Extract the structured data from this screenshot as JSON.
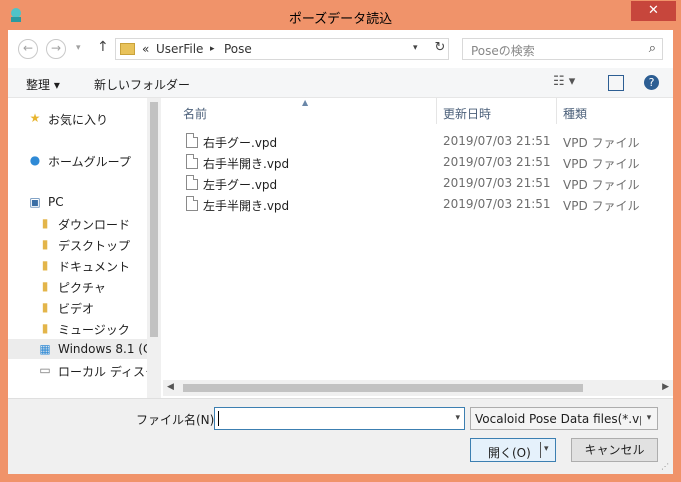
{
  "window": {
    "title": "ポーズデータ読込",
    "close_glyph": "✕",
    "accent": "#f0936a"
  },
  "nav": {
    "back_glyph": "←",
    "forward_glyph": "→",
    "recent_glyph": "▾",
    "up_glyph": "↑",
    "crumb_prefix": "«",
    "breadcrumb": [
      "UserFile",
      "Pose"
    ],
    "crumb_sep": "▸",
    "refresh_glyph": "↻",
    "search_placeholder": "Poseの検索",
    "search_glyph": "⌕"
  },
  "toolbar": {
    "organize_label": "整理 ▾",
    "new_folder_label": "新しいフォルダー",
    "view_glyph": "☷ ▾",
    "help_glyph": "?"
  },
  "sidebar": {
    "items": [
      {
        "label": "お気に入り",
        "icon": "star-icon",
        "glyph": "★"
      },
      {
        "label": "ホームグループ",
        "icon": "homegroup-icon",
        "glyph": "●"
      },
      {
        "label": "PC",
        "icon": "computer-icon",
        "glyph": "▣"
      },
      {
        "label": "ダウンロード",
        "icon": "folder-icon",
        "glyph": "▮"
      },
      {
        "label": "デスクトップ",
        "icon": "folder-icon",
        "glyph": "▮"
      },
      {
        "label": "ドキュメント",
        "icon": "folder-icon",
        "glyph": "▮"
      },
      {
        "label": "ピクチャ",
        "icon": "folder-icon",
        "glyph": "▮"
      },
      {
        "label": "ビデオ",
        "icon": "folder-icon",
        "glyph": "▮"
      },
      {
        "label": "ミュージック",
        "icon": "folder-icon",
        "glyph": "▮"
      },
      {
        "label": "Windows 8.1 (C",
        "icon": "windows-drive-icon",
        "glyph": "▦"
      },
      {
        "label": "ローカル ディスク (",
        "icon": "disk-icon",
        "glyph": "▭"
      }
    ]
  },
  "files": {
    "sort_glyph": "▲",
    "columns": {
      "name": "名前",
      "date": "更新日時",
      "type": "種類"
    },
    "rows": [
      {
        "name": "右手グー.vpd",
        "date": "2019/07/03 21:51",
        "type": "VPD ファイル"
      },
      {
        "name": "右手半開き.vpd",
        "date": "2019/07/03 21:51",
        "type": "VPD ファイル"
      },
      {
        "name": "左手グー.vpd",
        "date": "2019/07/03 21:51",
        "type": "VPD ファイル"
      },
      {
        "name": "左手半開き.vpd",
        "date": "2019/07/03 21:51",
        "type": "VPD ファイル"
      }
    ],
    "scroll_left_glyph": "◀",
    "scroll_right_glyph": "▶"
  },
  "footer": {
    "filename_label": "ファイル名(N):",
    "filename_value": "",
    "dropdown_glyph": "▾",
    "filter_value": "Vocaloid Pose Data files(*.vpd)",
    "open_label": "開く(O)",
    "cancel_label": "キャンセル",
    "grip_glyph": "⋰"
  }
}
